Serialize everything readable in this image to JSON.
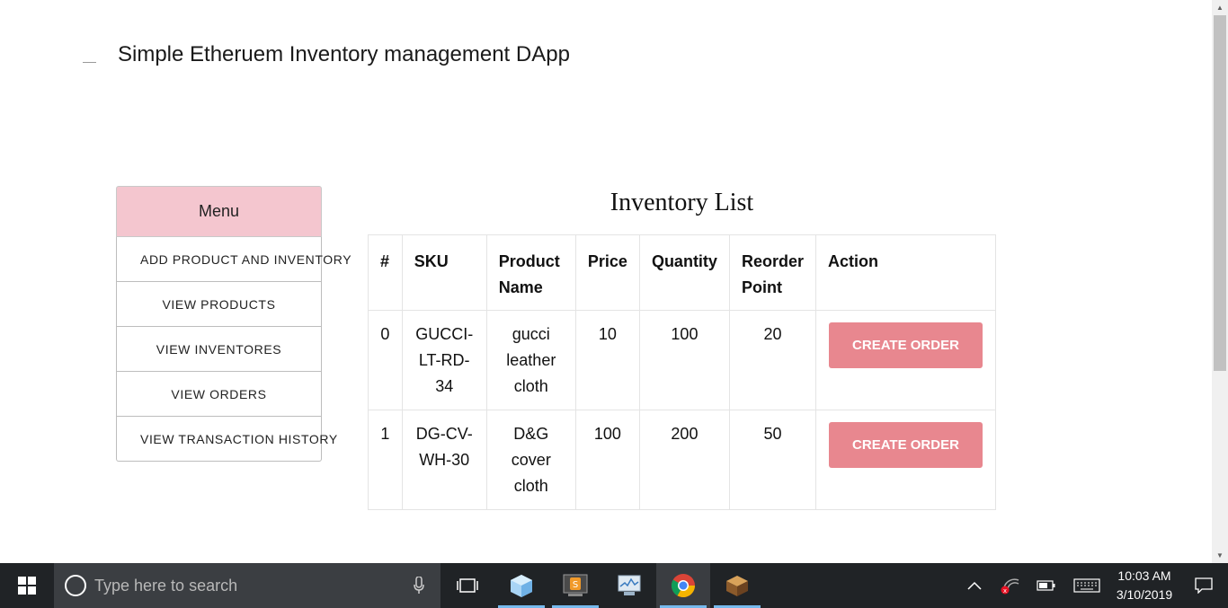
{
  "app": {
    "title": "Simple Etheruem Inventory management DApp"
  },
  "menu": {
    "header": "Menu",
    "items": [
      {
        "label": "ADD PRODUCT AND INVENTORY"
      },
      {
        "label": "VIEW PRODUCTS"
      },
      {
        "label": "VIEW INVENTORES"
      },
      {
        "label": "VIEW ORDERS"
      },
      {
        "label": "VIEW TRANSACTION HISTORY"
      }
    ]
  },
  "inventory": {
    "title": "Inventory List",
    "columns": [
      "#",
      "SKU",
      "Product Name",
      "Price",
      "Quantity",
      "Reorder Point",
      "Action"
    ],
    "rows": [
      {
        "index": "0",
        "sku": "GUCCI-LT-RD-34",
        "name": "gucci leather cloth",
        "price": "10",
        "quantity": "100",
        "reorder": "20",
        "action": "CREATE ORDER"
      },
      {
        "index": "1",
        "sku": "DG-CV-WH-30",
        "name": "D&G cover cloth",
        "price": "100",
        "quantity": "200",
        "reorder": "50",
        "action": "CREATE ORDER"
      }
    ],
    "button_color": "#e8878f"
  },
  "taskbar": {
    "search_placeholder": "Type here to search",
    "time": "10:03 AM",
    "date": "3/10/2019",
    "pinned": [
      "task-view-icon",
      "3d-box-app-icon",
      "sublime-text-icon",
      "performance-monitor-icon",
      "chrome-icon",
      "minecraft-icon"
    ]
  },
  "colors": {
    "menu_header": "#f4c6cf",
    "taskbar": "#202326",
    "accent": "#76b9ed"
  }
}
